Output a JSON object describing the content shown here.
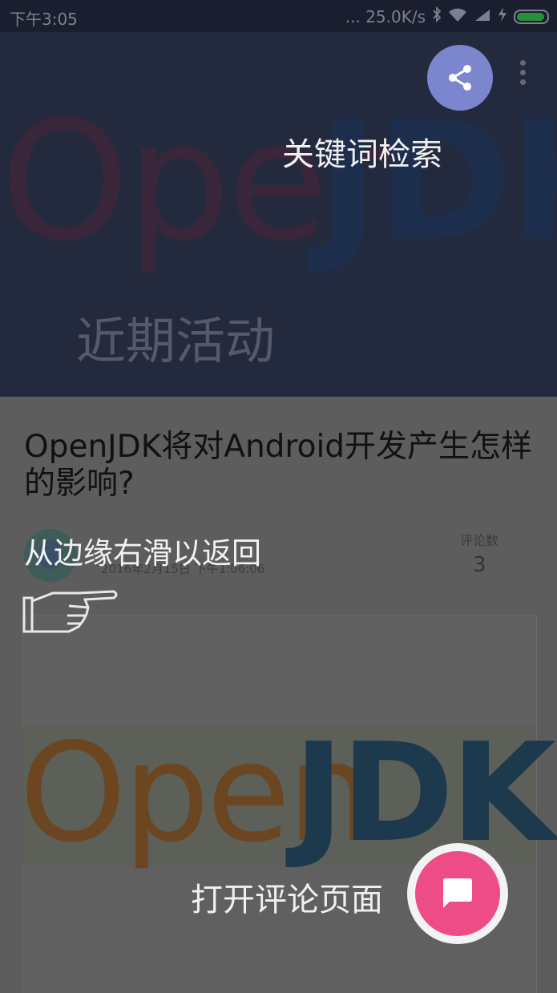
{
  "status_bar": {
    "time": "下午3:05",
    "network_speed": "... 25.0K/s",
    "icons": [
      "bluetooth-icon",
      "wifi-icon",
      "signal-icon",
      "charging-icon",
      "battery-icon"
    ]
  },
  "header": {
    "logo_open": "Open",
    "logo_jdk": "JDK",
    "subtitle": "近期活动",
    "share_icon": "share-icon",
    "more_icon": "more-vertical-icon"
  },
  "tutorial": {
    "search_hint": "关键词检索",
    "swipe_hint": "从边缘右滑以返回",
    "comments_hint": "打开评论页面"
  },
  "article": {
    "title": "OpenJDK将对Android开发产生怎样的影响?",
    "date": "2016年2月15日 下午1:06:06",
    "comment_label": "评论数",
    "comment_count": "3",
    "image_open": "Open",
    "image_jdk": "JDK"
  },
  "colors": {
    "share_fab": "#7b86cf",
    "comment_fab": "#ee4c86",
    "header_bg": "#242a3e"
  }
}
